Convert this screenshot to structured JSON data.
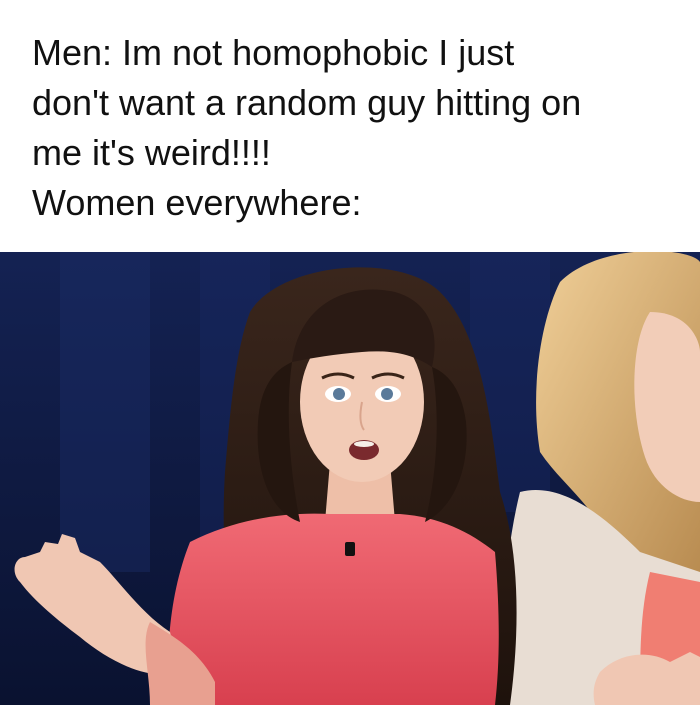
{
  "caption": {
    "lines": [
      "Men: Im not homophobic I just",
      "don't want a random guy hitting on",
      "me it's weird!!!!",
      "Women everywhere:"
    ]
  },
  "photo": {
    "background_color": "#0f1a3a",
    "left_person_top_color": "#e8505e",
    "left_person_hair_color": "#2a1a14",
    "right_person_hair_color": "#d9b27a",
    "right_person_cardigan_color": "#e8ddd3",
    "right_person_top_color": "#f07e72",
    "skin_color": "#f0c7b3"
  }
}
